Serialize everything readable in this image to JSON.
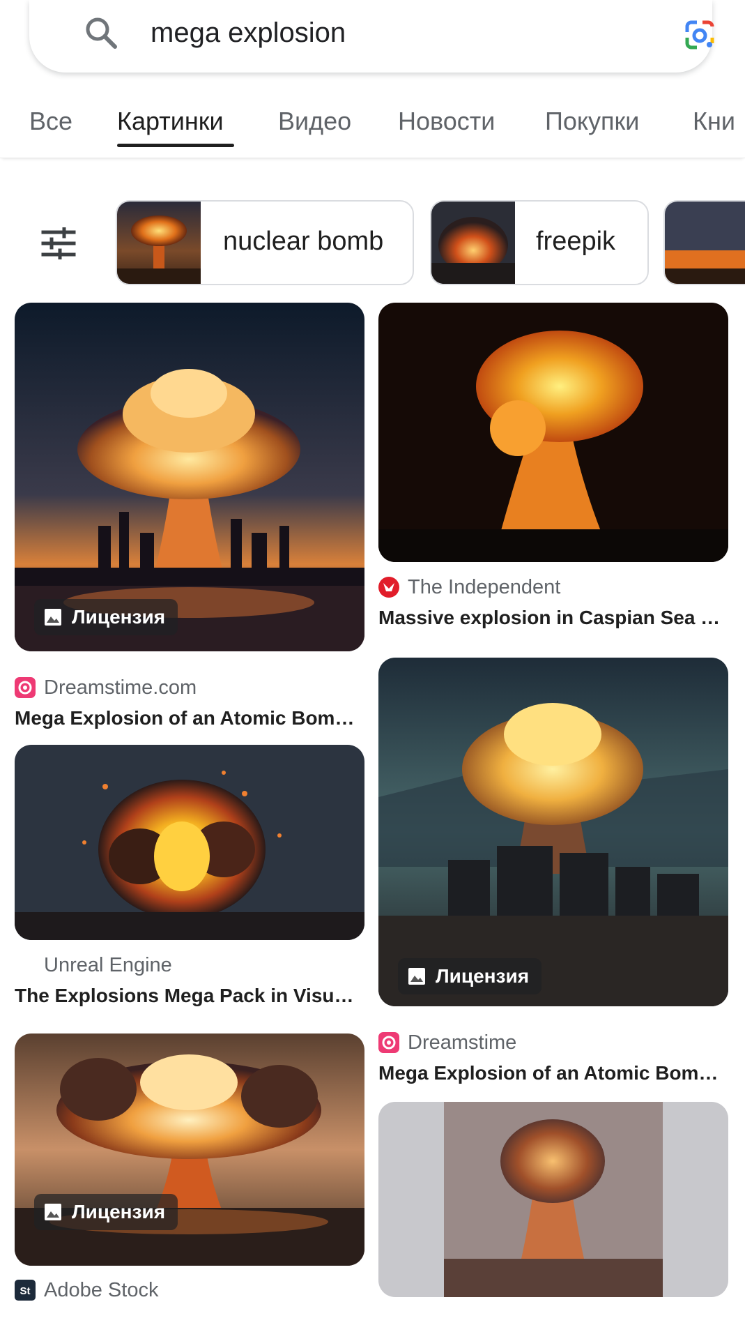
{
  "search": {
    "query": "mega explosion"
  },
  "tabs": [
    {
      "label": "Все"
    },
    {
      "label": "Картинки"
    },
    {
      "label": "Видео"
    },
    {
      "label": "Новости"
    },
    {
      "label": "Покупки"
    },
    {
      "label": "Кни"
    }
  ],
  "chips": [
    {
      "label": "nuclear bomb"
    },
    {
      "label": "freepik"
    }
  ],
  "results": [
    {
      "source": "Dreamstime.com",
      "title": "Mega Explosion of an Atomic Bom…",
      "badge": "Лицензия"
    },
    {
      "source": "The Independent",
      "title": "Massive explosion in Caspian Sea …"
    },
    {
      "source": "Unreal Engine",
      "title": "The Explosions Mega Pack in Visu…"
    },
    {
      "source": "Dreamstime",
      "title": "Mega Explosion of an Atomic Bom…",
      "badge": "Лицензия"
    },
    {
      "source": "Adobe Stock",
      "badge": "Лицензия"
    },
    {
      "source": ""
    }
  ],
  "colors": {
    "accent": "#1f1f1f",
    "muted": "#5f6368",
    "border": "#dadce0"
  }
}
